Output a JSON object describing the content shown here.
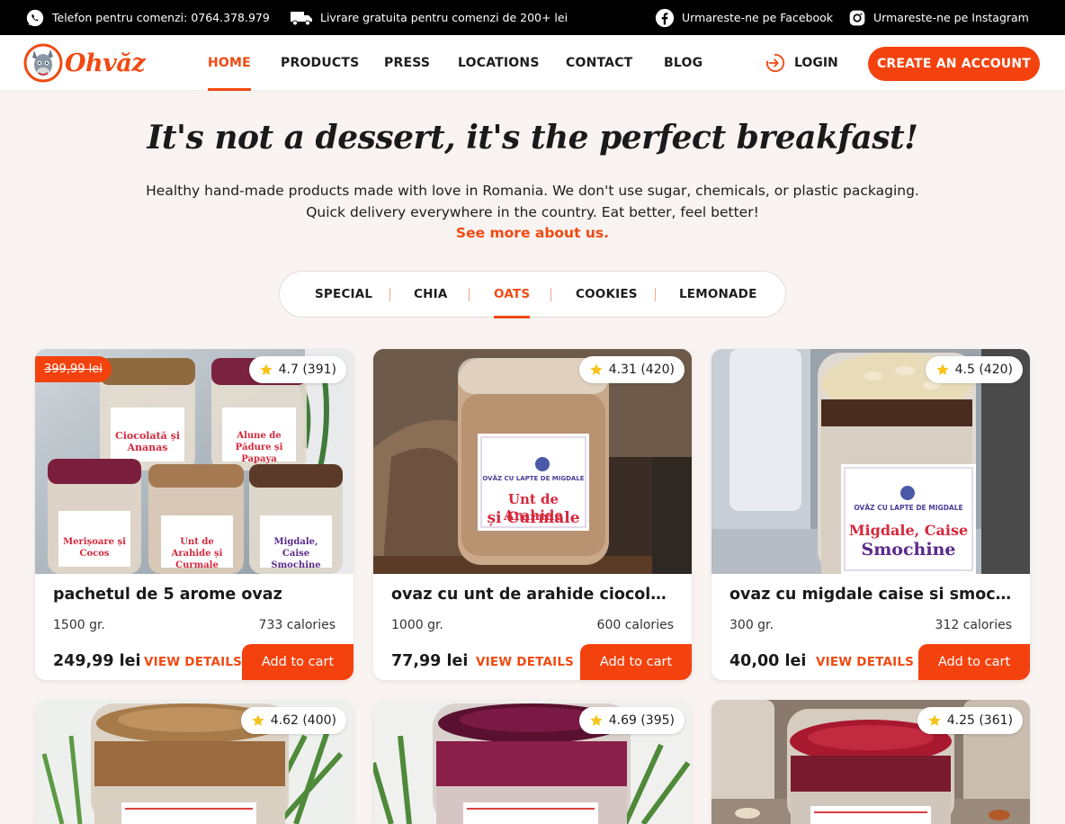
{
  "topbar": {
    "phone": "Telefon pentru comenzi: 0764.378.979",
    "delivery": "Livrare gratuita pentru comenzi de 200+ lei",
    "facebook": "Urmareste-ne pe Facebook",
    "instagram": "Urmareste-ne pe Instagram"
  },
  "header": {
    "logo": "Ohvăz",
    "nav": [
      "HOME",
      "PRODUCTS",
      "PRESS",
      "LOCATIONS",
      "CONTACT",
      "BLOG"
    ],
    "active_nav": "HOME",
    "login": "LOGIN",
    "create_account": "CREATE AN ACCOUNT"
  },
  "hero": {
    "title": "It's not a dessert, it's the perfect breakfast!",
    "line1": "Healthy hand-made products made with love in Romania. We don't use sugar, chemicals, or plastic packaging.",
    "line2": "Quick delivery everywhere in the country. Eat better, feel better!",
    "link": "See more about us."
  },
  "tabs": {
    "items": [
      "SPECIAL",
      "CHIA",
      "OATS",
      "COOKIES",
      "LEMONADE"
    ],
    "active": "OATS"
  },
  "products": [
    {
      "old_price": "399,99 lei",
      "rating": "4.7 (391)",
      "title": "pachetul de 5 arome ovaz",
      "weight": "1500 gr.",
      "calories": "733 calories",
      "price": "249,99 lei",
      "view": "VIEW DETAILS",
      "cart": "Add to cart",
      "jar_labels": [
        "Ciocolată și Ananas",
        "Alune de Pădure și Papaya",
        "Merișoare și Cocos",
        "Unt de Arahide și Curmale",
        "Migdale, Caise Smochine"
      ]
    },
    {
      "rating": "4.31 (420)",
      "title": "ovaz cu unt de arahide ciocolat...",
      "weight": "1000 gr.",
      "calories": "600 calories",
      "price": "77,99 lei",
      "view": "VIEW DETAILS",
      "cart": "Add to cart",
      "jar_labels": [
        "OVĂZ CU LAPTE DE MIGDALE",
        "Unt de Arahide",
        "și Curmale"
      ]
    },
    {
      "rating": "4.5 (420)",
      "title": "ovaz cu migdale caise si smochi...",
      "weight": "300 gr.",
      "calories": "312 calories",
      "price": "40,00 lei",
      "view": "VIEW DETAILS",
      "cart": "Add to cart",
      "jar_labels": [
        "OVĂZ CU LAPTE DE MIGDALE",
        "Migdale, Caise",
        "Smochine"
      ]
    },
    {
      "rating": "4.62 (400)"
    },
    {
      "rating": "4.69 (395)"
    },
    {
      "rating": "4.25 (361)"
    }
  ],
  "colors": {
    "accent": "#f4420e",
    "topbar": "#000000",
    "page_bg": "#f9f3f1",
    "star": "#f7c31a"
  }
}
